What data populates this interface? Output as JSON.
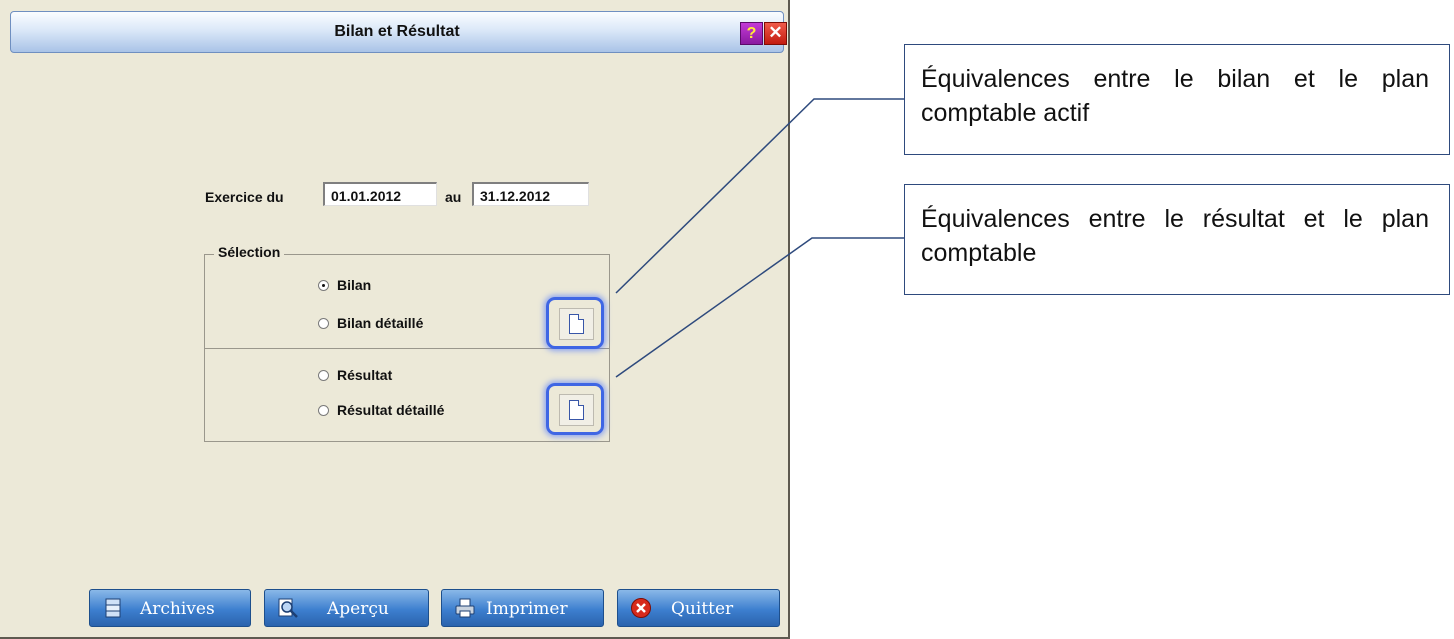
{
  "window": {
    "title": "Bilan et Résultat",
    "help_icon": "help-icon",
    "close_icon": "close-icon"
  },
  "period": {
    "from_label": "Exercice du",
    "from_value": "01.01.2012",
    "to_label": "au",
    "to_value": "31.12.2012"
  },
  "selection": {
    "legend": "Sélection",
    "options": [
      {
        "label": "Bilan",
        "checked": true
      },
      {
        "label": "Bilan détaillé",
        "checked": false
      },
      {
        "label": "Résultat",
        "checked": false
      },
      {
        "label": "Résultat détaillé",
        "checked": false
      }
    ],
    "doc_buttons": [
      "document-icon",
      "document-icon"
    ]
  },
  "buttons": {
    "archives": "Archives",
    "apercu": "Aperçu",
    "imprimer": "Imprimer",
    "quitter": "Quitter"
  },
  "callouts": [
    "Équivalences entre le bilan et le plan comptable actif",
    "Équivalences entre le résultat et le plan comptable"
  ],
  "colors": {
    "dialog_bg": "#ece9d8",
    "button_blue": "#3d7fcf",
    "highlight": "#3f66e4",
    "callout_line": "#2e4a7d"
  }
}
